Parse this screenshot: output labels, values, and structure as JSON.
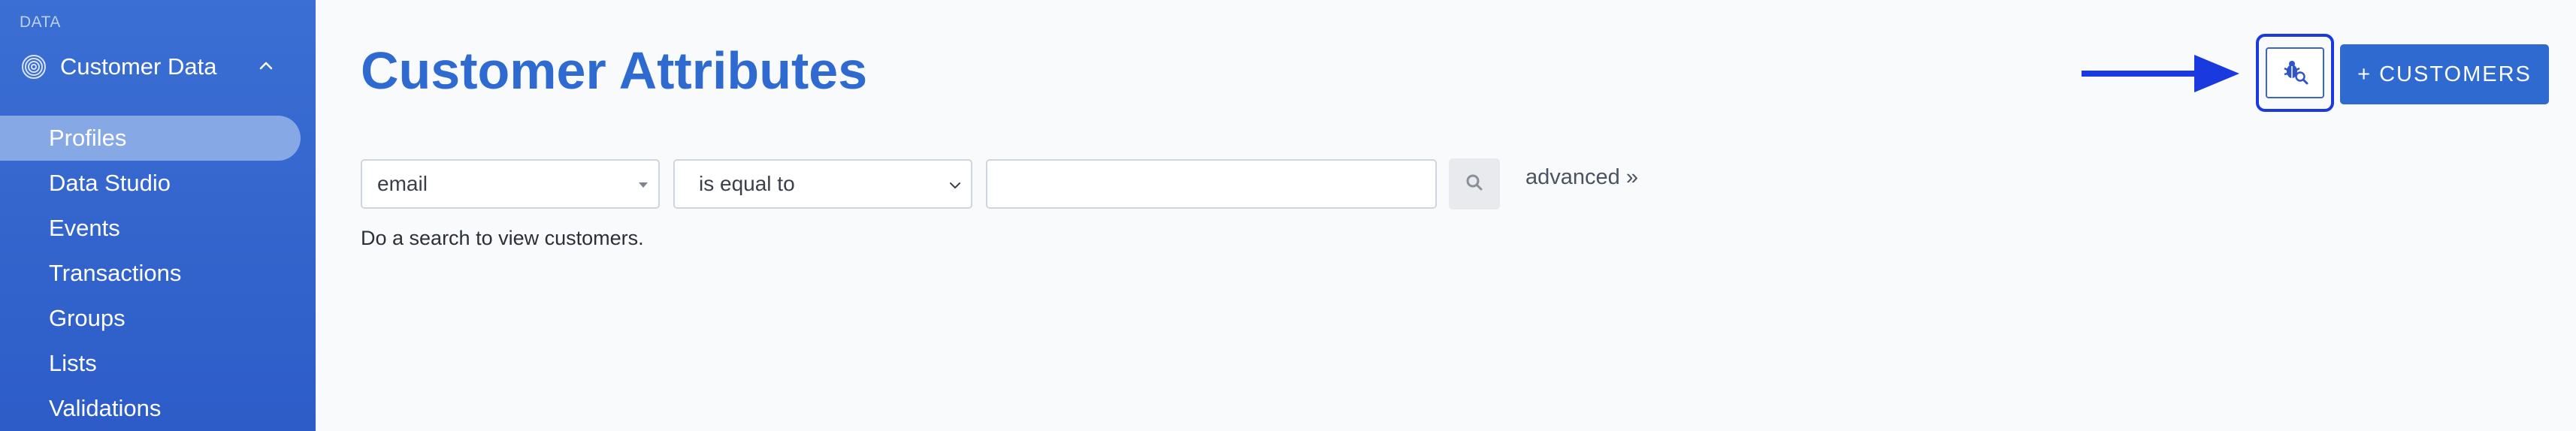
{
  "sidebar": {
    "section_label": "DATA",
    "group": {
      "label": "Customer Data",
      "icon": "fingerprint-icon",
      "expanded": true
    },
    "items": [
      {
        "label": "Profiles",
        "active": true
      },
      {
        "label": "Data Studio",
        "active": false
      },
      {
        "label": "Events",
        "active": false
      },
      {
        "label": "Transactions",
        "active": false
      },
      {
        "label": "Groups",
        "active": false
      },
      {
        "label": "Lists",
        "active": false
      },
      {
        "label": "Validations",
        "active": false
      }
    ]
  },
  "header": {
    "title": "Customer Attributes",
    "debug_button_icon": "bug-search-icon",
    "add_button_label": "+ CUSTOMERS"
  },
  "filter": {
    "field_value": "email",
    "operator_value": "is equal to",
    "value_input": "",
    "search_icon": "search-icon",
    "advanced_link": "advanced »"
  },
  "hint": "Do a search to view customers.",
  "colors": {
    "sidebar_bg": "#2d5cc8",
    "accent": "#2f6ad0",
    "annotation": "#1a3ae0",
    "page_bg": "#f9fafc"
  }
}
